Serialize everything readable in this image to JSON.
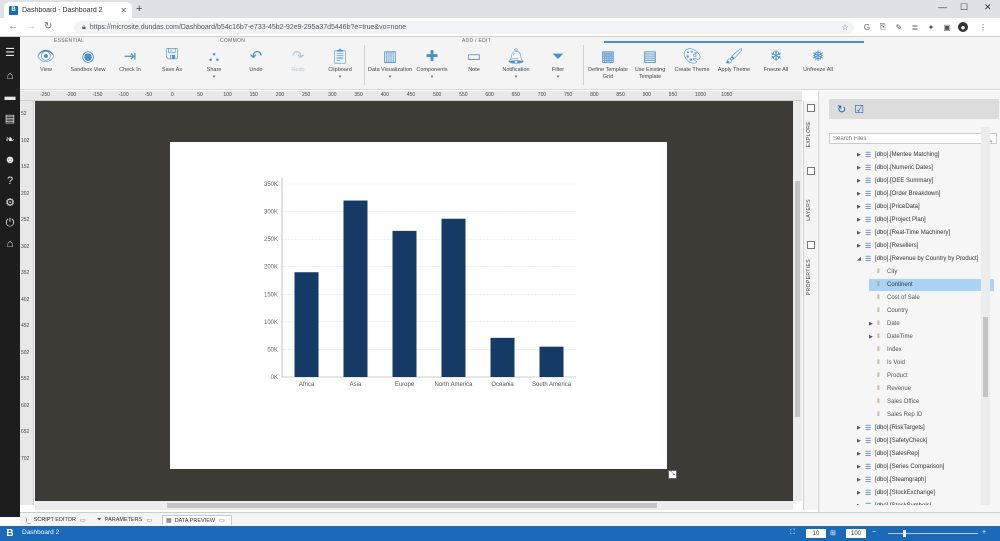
{
  "browser": {
    "tab_title": "Dashboard - Dashboard 2",
    "favicon": "B",
    "url": "https://microsite.dundas.com/Dashboard/b54c16b7-e733-45b2-92e9-295a37d5446b?e=true&vo=none"
  },
  "ribbon": {
    "groups": [
      "ESSENTIAL",
      "COMMON",
      "ADD / EDIT"
    ],
    "buttons": [
      {
        "label": "View",
        "icon": "eye-icon"
      },
      {
        "label": "Sandbox View",
        "icon": "sandbox-eye-icon"
      },
      {
        "label": "Check In",
        "icon": "check-in-icon"
      },
      {
        "label": "Save As",
        "icon": "save-as-icon"
      },
      {
        "label": "Share",
        "icon": "share-icon"
      },
      {
        "label": "Undo",
        "icon": "undo-icon"
      },
      {
        "label": "Redo",
        "icon": "redo-icon"
      },
      {
        "label": "Clipboard",
        "icon": "clipboard-icon"
      },
      {
        "label": "Data Visualization",
        "icon": "data-visualization-icon"
      },
      {
        "label": "Components",
        "icon": "components-icon"
      },
      {
        "label": "Note",
        "icon": "note-icon"
      },
      {
        "label": "Notification",
        "icon": "notification-icon"
      },
      {
        "label": "Filter",
        "icon": "filter-icon"
      },
      {
        "label": "Define Template Grid",
        "icon": "template-grid-icon"
      },
      {
        "label": "Use Existing Template",
        "icon": "use-template-icon"
      },
      {
        "label": "Create Theme",
        "icon": "create-theme-icon"
      },
      {
        "label": "Apply Theme",
        "icon": "apply-theme-icon"
      },
      {
        "label": "Freeze All",
        "icon": "freeze-icon"
      },
      {
        "label": "Unfreeze All",
        "icon": "unfreeze-icon"
      }
    ]
  },
  "rulers": {
    "corner": "px",
    "top": [
      "-250",
      "-200",
      "-150",
      "-100",
      "-50",
      "0",
      "50",
      "100",
      "150",
      "200",
      "250",
      "300",
      "350",
      "400",
      "450",
      "500",
      "550",
      "600",
      "650",
      "700",
      "750",
      "800",
      "850",
      "900",
      "950",
      "1000",
      "1050"
    ],
    "left": [
      "52",
      "102",
      "152",
      "202",
      "252",
      "302",
      "352",
      "402",
      "452",
      "502",
      "552",
      "602",
      "652",
      "702"
    ]
  },
  "side_tabs": [
    "EXPLORE",
    "LAYERS",
    "PROPERTIES"
  ],
  "explore": {
    "search_placeholder": "Search Files",
    "tree": [
      {
        "label": "[dbo].[Mentee Matching]",
        "type": "table",
        "level": 0,
        "expand": "collapsed"
      },
      {
        "label": "[dbo].[Numeric Dates]",
        "type": "table",
        "level": 0,
        "expand": "collapsed"
      },
      {
        "label": "[dbo].[OEE Summary]",
        "type": "table",
        "level": 0,
        "expand": "collapsed"
      },
      {
        "label": "[dbo].[Order Breakdown]",
        "type": "table",
        "level": 0,
        "expand": "collapsed"
      },
      {
        "label": "[dbo].[PriceData]",
        "type": "table",
        "level": 0,
        "expand": "collapsed"
      },
      {
        "label": "[dbo].[Project Plan]",
        "type": "table",
        "level": 0,
        "expand": "collapsed"
      },
      {
        "label": "[dbo].[Real-Time Machinery]",
        "type": "table",
        "level": 0,
        "expand": "collapsed"
      },
      {
        "label": "[dbo].[Resellers]",
        "type": "table",
        "level": 0,
        "expand": "collapsed"
      },
      {
        "label": "[dbo].[Revenue by Country by Product]",
        "type": "table",
        "level": 0,
        "expand": "expanded"
      },
      {
        "label": "City",
        "type": "field",
        "level": 1,
        "expand": "none"
      },
      {
        "label": "Continent",
        "type": "field",
        "level": 1,
        "expand": "none",
        "selected": true
      },
      {
        "label": "Cost of Sale",
        "type": "field",
        "level": 1,
        "expand": "none"
      },
      {
        "label": "Country",
        "type": "field",
        "level": 1,
        "expand": "none"
      },
      {
        "label": "Date",
        "type": "field",
        "level": 1,
        "expand": "collapsed"
      },
      {
        "label": "DateTime",
        "type": "field",
        "level": 1,
        "expand": "collapsed"
      },
      {
        "label": "Index",
        "type": "field",
        "level": 1,
        "expand": "none"
      },
      {
        "label": "Is Void",
        "type": "field",
        "level": 1,
        "expand": "none"
      },
      {
        "label": "Product",
        "type": "field",
        "level": 1,
        "expand": "none"
      },
      {
        "label": "Revenue",
        "type": "field",
        "level": 1,
        "expand": "none"
      },
      {
        "label": "Sales Office",
        "type": "field",
        "level": 1,
        "expand": "none"
      },
      {
        "label": "Sales Rep ID",
        "type": "field",
        "level": 1,
        "expand": "none"
      },
      {
        "label": "[dbo].[RiskTargets]",
        "type": "table",
        "level": 0,
        "expand": "collapsed"
      },
      {
        "label": "[dbo].[SafetyCheck]",
        "type": "table",
        "level": 0,
        "expand": "collapsed"
      },
      {
        "label": "[dbo].[SalesRep]",
        "type": "table",
        "level": 0,
        "expand": "collapsed"
      },
      {
        "label": "[dbo].[Series Comparison]",
        "type": "table",
        "level": 0,
        "expand": "collapsed"
      },
      {
        "label": "[dbo].[Steamgraph]",
        "type": "table",
        "level": 0,
        "expand": "collapsed"
      },
      {
        "label": "[dbo].[StockExchange]",
        "type": "table",
        "level": 0,
        "expand": "collapsed"
      },
      {
        "label": "[dbo].[StockSymbols]",
        "type": "table",
        "level": 0,
        "expand": "collapsed"
      }
    ]
  },
  "bottom_tabs": [
    "SCRIPT EDITOR",
    "PARAMETERS",
    "DATA PREVIEW"
  ],
  "status": {
    "logo": "B",
    "dashboard_name": "Dashboard 2",
    "grid_size": "10",
    "zoom": "100"
  },
  "colors": {
    "accent": "#1a6ab8",
    "bar": "#163a66",
    "canvas": "#3c3b35",
    "selected": "#a9d3f5"
  },
  "chart_data": {
    "type": "bar",
    "categories": [
      "Africa",
      "Asia",
      "Europe",
      "North America",
      "Oceania",
      "South America"
    ],
    "values": [
      190000,
      320000,
      265000,
      287000,
      71000,
      55000
    ],
    "ylim": [
      0,
      350000
    ],
    "yticks": [
      "0K",
      "50K",
      "100K",
      "150K",
      "200K",
      "250K",
      "300K",
      "350K"
    ],
    "title": "",
    "xlabel": "",
    "ylabel": "",
    "grid": true
  }
}
